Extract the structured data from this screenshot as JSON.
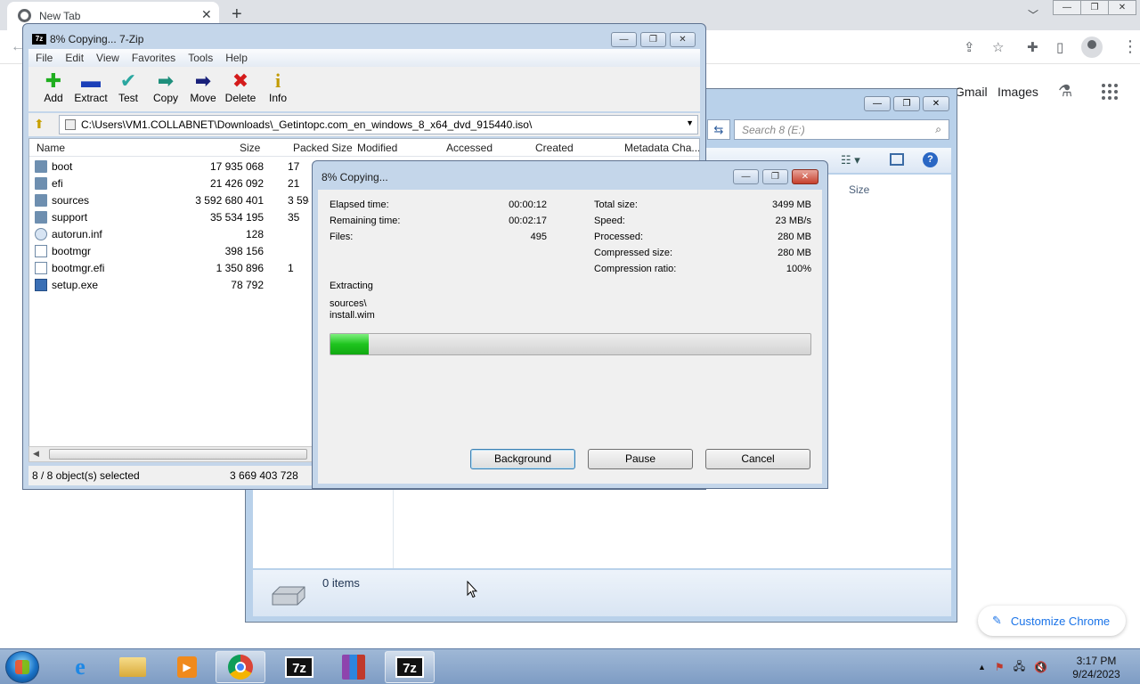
{
  "chrome": {
    "tab_title": "New Tab",
    "gmail": "Gmail",
    "images": "Images",
    "customize": "Customize Chrome"
  },
  "explorer": {
    "search_placeholder": "Search 8 (E:)",
    "size_col": "Size",
    "items": "0 items"
  },
  "sevenzip": {
    "title": "8% Copying... 7-Zip",
    "menu": [
      "File",
      "Edit",
      "View",
      "Favorites",
      "Tools",
      "Help"
    ],
    "toolbar": {
      "add": "Add",
      "extract": "Extract",
      "test": "Test",
      "copy": "Copy",
      "move": "Move",
      "delete": "Delete",
      "info": "Info"
    },
    "path": "C:\\Users\\VM1.COLLABNET\\Downloads\\_Getintopc.com_en_windows_8_x64_dvd_915440.iso\\",
    "columns": {
      "name": "Name",
      "size": "Size",
      "packed": "Packed Size",
      "modified": "Modified",
      "accessed": "Accessed",
      "created": "Created",
      "metadata": "Metadata Cha..."
    },
    "rows": [
      {
        "name": "boot",
        "size": "17 935 068",
        "packed": "17"
      },
      {
        "name": "efi",
        "size": "21 426 092",
        "packed": "21"
      },
      {
        "name": "sources",
        "size": "3 592 680 401",
        "packed": "3 594"
      },
      {
        "name": "support",
        "size": "35 534 195",
        "packed": "35"
      },
      {
        "name": "autorun.inf",
        "size": "128",
        "packed": ""
      },
      {
        "name": "bootmgr",
        "size": "398 156",
        "packed": ""
      },
      {
        "name": "bootmgr.efi",
        "size": "1 350 896",
        "packed": "1"
      },
      {
        "name": "setup.exe",
        "size": "78 792",
        "packed": ""
      }
    ],
    "status_selected": "8 / 8 object(s) selected",
    "status_size": "3 669 403 728"
  },
  "dialog": {
    "title": "8% Copying...",
    "elapsed_label": "Elapsed time:",
    "elapsed": "00:00:12",
    "remaining_label": "Remaining time:",
    "remaining": "00:02:17",
    "files_label": "Files:",
    "files": "495",
    "total_label": "Total size:",
    "total": "3499 MB",
    "speed_label": "Speed:",
    "speed": "23 MB/s",
    "processed_label": "Processed:",
    "processed": "280 MB",
    "compressed_label": "Compressed size:",
    "compressed": "280 MB",
    "ratio_label": "Compression ratio:",
    "ratio": "100%",
    "extracting": "Extracting",
    "current_dir": "sources\\",
    "current_file": "install.wim",
    "progress_percent": 8,
    "btn_background": "Background",
    "btn_pause": "Pause",
    "btn_cancel": "Cancel"
  },
  "taskbar": {
    "time": "3:17 PM",
    "date": "9/24/2023"
  }
}
